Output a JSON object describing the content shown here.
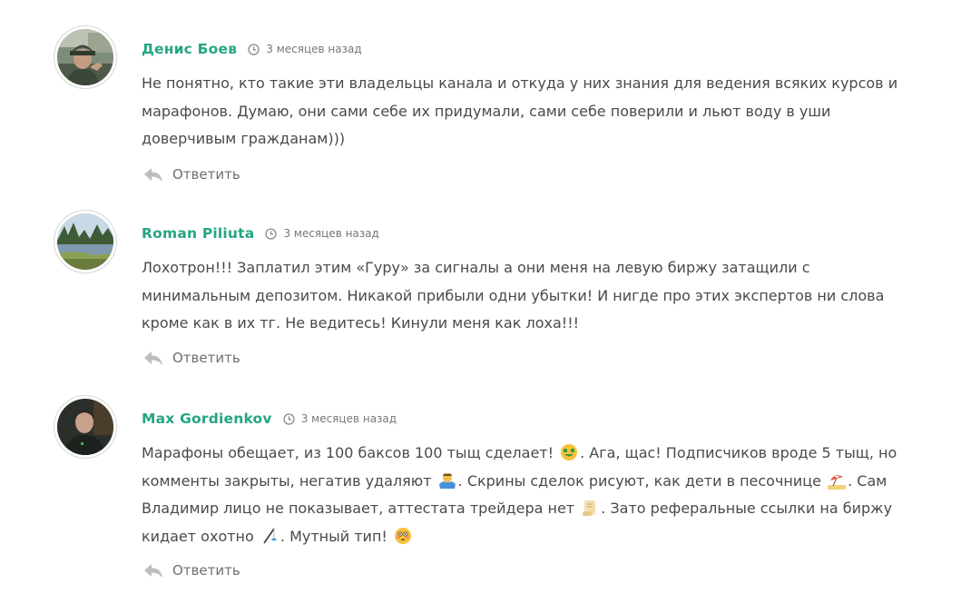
{
  "comments": [
    {
      "author": "Денис Боев",
      "time": "3 месяцев назад",
      "text": "Не понятно, кто такие эти владельцы канала и откуда у них знания для ведения всяких курсов и марафонов. Думаю, они сами себе их придумали, сами себе поверили и льют воду в уши доверчивым гражданам)))",
      "reply_label": "Ответить",
      "avatar_icon": "user-photo-man-with-hat"
    },
    {
      "author": "Roman Piliuta",
      "time": "3 месяцев назад",
      "text": "Лохотрон!!! Заплатил этим «Гуру» за сигналы а они меня на левую биржу затащили с минимальным депозитом. Никакой прибыли одни убытки! И нигде про этих экспертов ни слова кроме как в их тг. Не ведитесь! Кинули меня как лоха!!!",
      "reply_label": "Ответить",
      "avatar_icon": "landscape-lake-photo"
    },
    {
      "author": "Max Gordienkov",
      "time": "3 месяцев назад",
      "text_parts": [
        "Марафоны обещает, из 100 баксов 100 тыщ сделает! ",
        ". Ага, щас! Подписчиков вроде 5 тыщ, но комменты закрыты, негатив удаляют ",
        ". Скрины сделок рисуют, как дети в песочнице ",
        ". Сам Владимир лицо не показывает, аттестата трейдера нет ",
        ". Зато реферальные ссылки на биржу кидает охотно ",
        ". Мутный тип! "
      ],
      "emojis": [
        "money-mouth-face-emoji",
        "person-shrugging-emoji",
        "beach-umbrella-emoji",
        "scroll-emoji",
        "fishing-pole-emoji",
        "flushed-face-emoji"
      ],
      "reply_label": "Ответить",
      "avatar_icon": "user-photo-man-dark-hoodie"
    }
  ],
  "colors": {
    "author": "#25a584",
    "text": "#4a4a4a",
    "meta": "#777777",
    "reply": "#6f6f6f"
  }
}
